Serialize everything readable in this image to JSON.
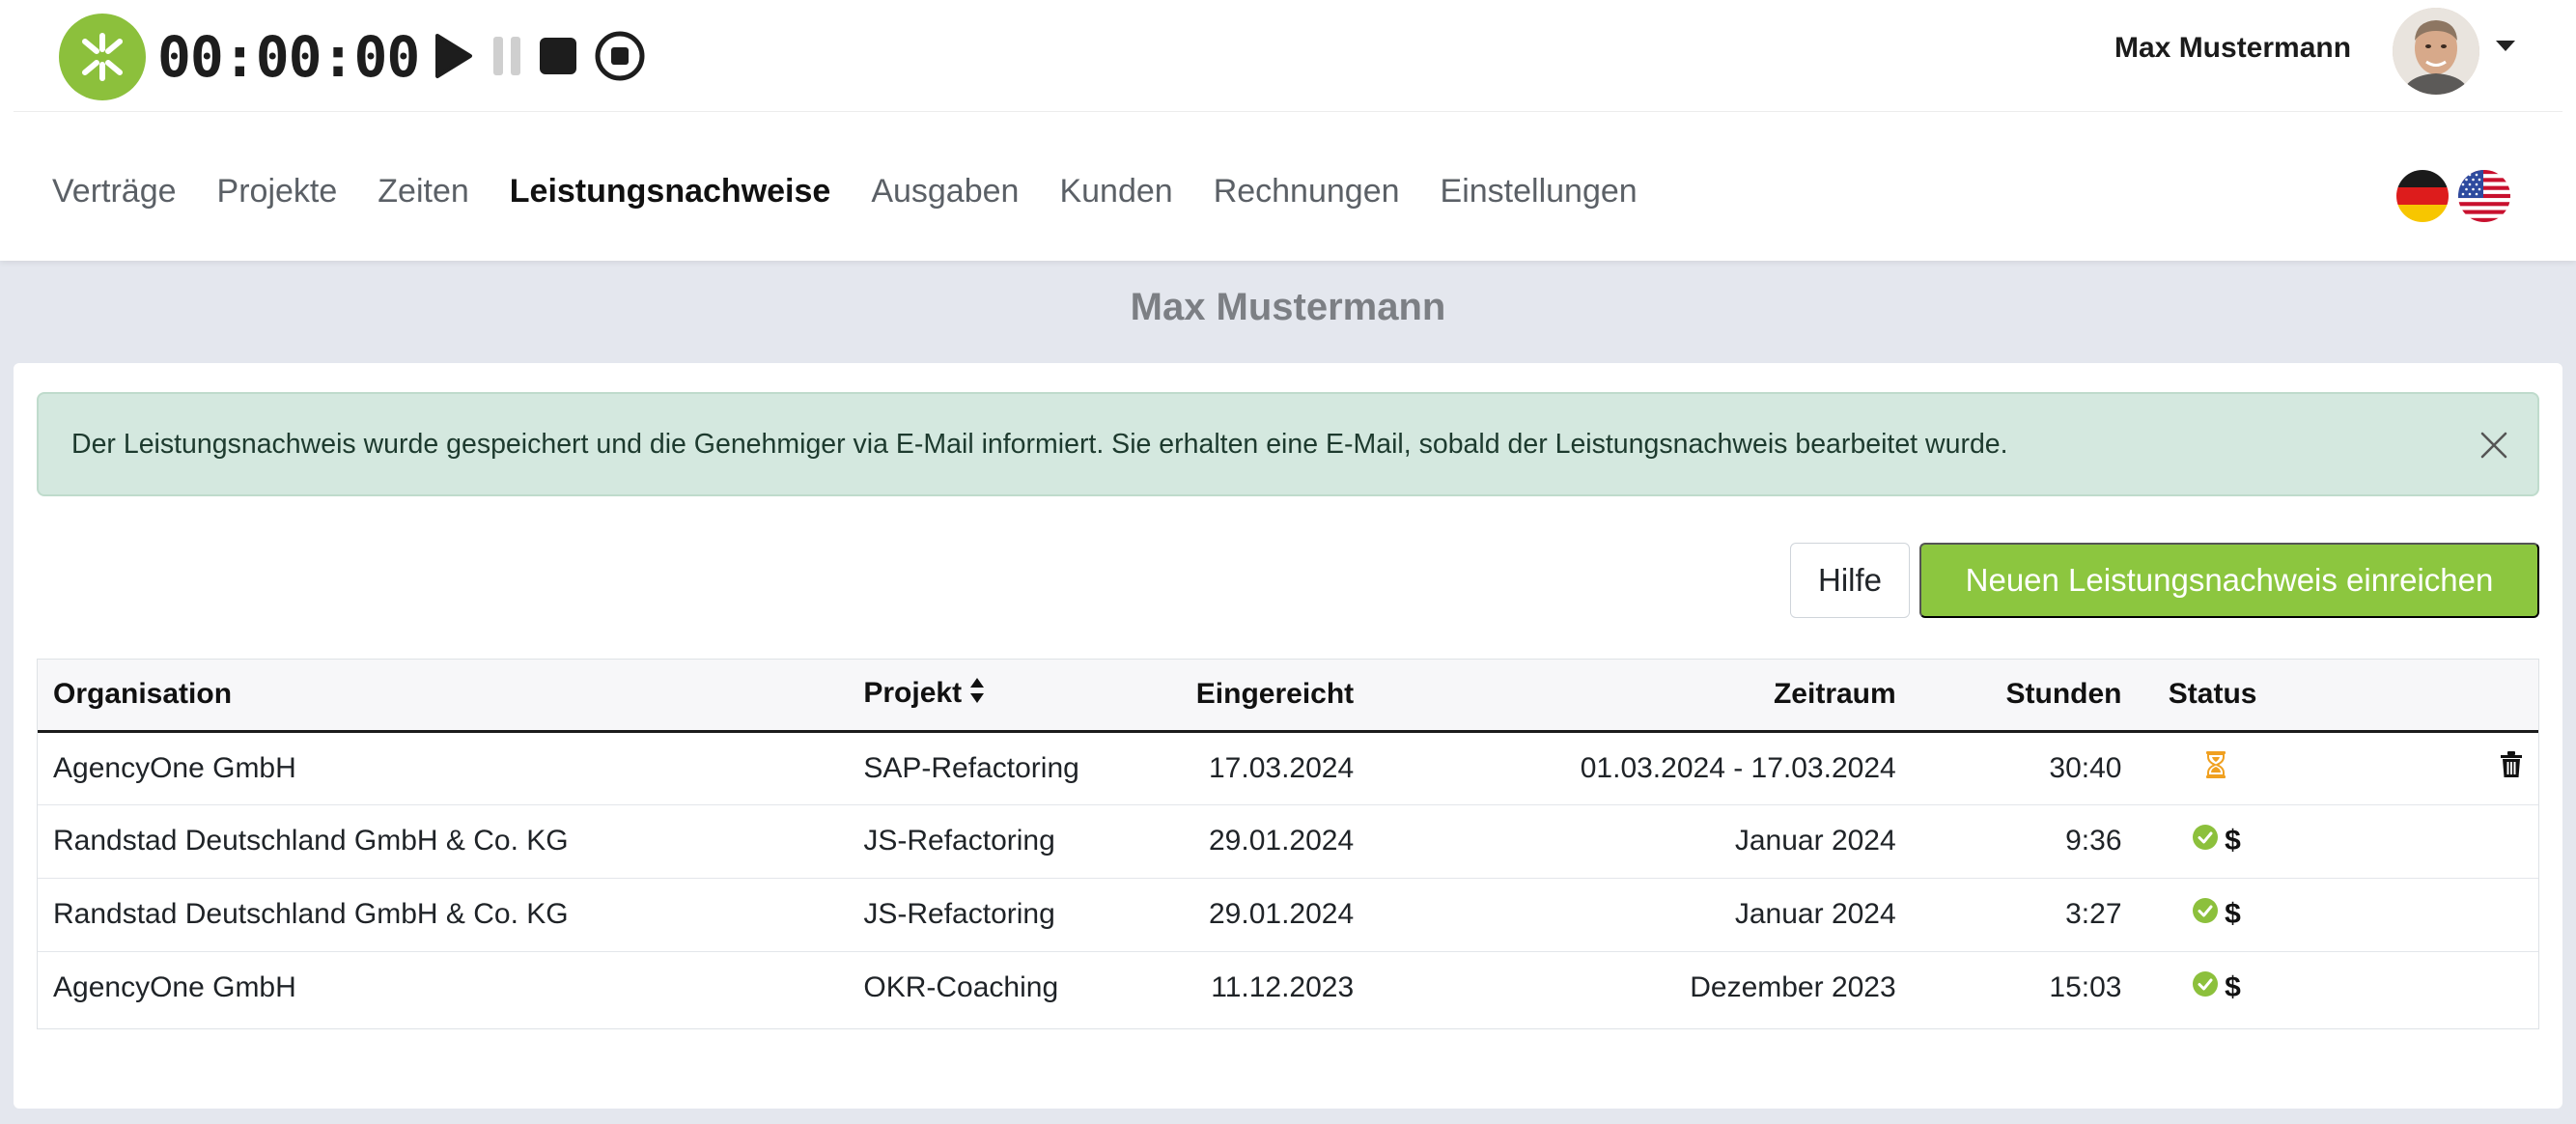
{
  "timer": {
    "display": "00:00:00"
  },
  "user": {
    "name": "Max Mustermann"
  },
  "nav": {
    "items": [
      {
        "label": "Verträge",
        "active": false
      },
      {
        "label": "Projekte",
        "active": false
      },
      {
        "label": "Zeiten",
        "active": false
      },
      {
        "label": "Leistungsnachweise",
        "active": true
      },
      {
        "label": "Ausgaben",
        "active": false
      },
      {
        "label": "Kunden",
        "active": false
      },
      {
        "label": "Rechnungen",
        "active": false
      },
      {
        "label": "Einstellungen",
        "active": false
      }
    ]
  },
  "page": {
    "title": "Max Mustermann"
  },
  "alert": {
    "message": "Der Leistungsnachweis wurde gespeichert und die Genehmiger via E-Mail informiert. Sie erhalten eine E-Mail, sobald der Leistungsnachweis bearbeitet wurde."
  },
  "actions": {
    "help_label": "Hilfe",
    "new_label": "Neuen Leistungsnachweis einreichen"
  },
  "table": {
    "headers": {
      "organisation": "Organisation",
      "projekt": "Projekt",
      "eingereicht": "Eingereicht",
      "zeitraum": "Zeitraum",
      "stunden": "Stunden",
      "status": "Status"
    },
    "rows": [
      {
        "organisation": "AgencyOne GmbH",
        "projekt": "SAP-Refactoring",
        "eingereicht": "17.03.2024",
        "zeitraum": "01.03.2024 - 17.03.2024",
        "stunden": "30:40",
        "status": "pending",
        "billed": "",
        "deletable": true
      },
      {
        "organisation": "Randstad Deutschland GmbH & Co. KG",
        "projekt": "JS-Refactoring",
        "eingereicht": "29.01.2024",
        "zeitraum": "Januar 2024",
        "stunden": "9:36",
        "status": "approved",
        "billed": "$",
        "deletable": false
      },
      {
        "organisation": "Randstad Deutschland GmbH & Co. KG",
        "projekt": "JS-Refactoring",
        "eingereicht": "29.01.2024",
        "zeitraum": "Januar 2024",
        "stunden": "3:27",
        "status": "approved",
        "billed": "$",
        "deletable": false
      },
      {
        "organisation": "AgencyOne GmbH",
        "projekt": "OKR-Coaching",
        "eingereicht": "11.12.2023",
        "zeitraum": "Dezember 2023",
        "stunden": "15:03",
        "status": "approved",
        "billed": "$",
        "deletable": false
      }
    ]
  },
  "colors": {
    "brand_green": "#8cc63f",
    "pending_orange": "#f0a020",
    "approved_green": "#8cc03c",
    "alert_bg": "#d4e8df"
  },
  "icons": {
    "logo": "app-logo-icon",
    "play": "play-icon",
    "pause": "pause-icon",
    "stop": "stop-icon",
    "record": "record-icon",
    "pending": "hourglass-icon",
    "approved": "check-circle-icon",
    "billed": "dollar-icon",
    "delete": "trash-icon",
    "close": "close-icon",
    "sort": "sort-icon",
    "flag_de": "flag-de-icon",
    "flag_us": "flag-us-icon"
  }
}
